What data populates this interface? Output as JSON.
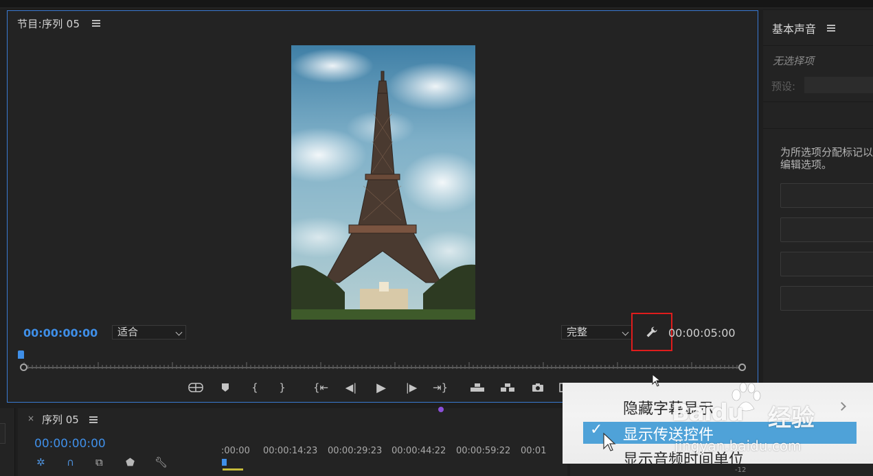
{
  "program_monitor": {
    "title": "节目:序列 05",
    "timecode_current": "00:00:00:00",
    "timecode_duration": "00:00:05:00",
    "zoom_select": "适合",
    "quality_select": "完整"
  },
  "essential_sound": {
    "title": "基本声音",
    "no_selection": "无选择项",
    "preset_label": "预设:",
    "description_line1": "为所选项分配标记以",
    "description_line2": "编辑选项。"
  },
  "timeline": {
    "close": "×",
    "title": "序列 05",
    "timecode": "00:00:00:00",
    "ruler_labels": [
      ":00:00",
      "00:00:14:23",
      "00:00:29:23",
      "00:00:44:22",
      "00:00:59:22",
      "00:01"
    ],
    "meter_label": "-12"
  },
  "context_menu": {
    "items": [
      {
        "label": "隐藏字幕显示",
        "checked": false,
        "has_submenu": true
      },
      {
        "label": "显示传送控件",
        "checked": true,
        "has_submenu": false
      },
      {
        "label": "显示音频时间单位",
        "checked": false,
        "has_submenu": false
      }
    ],
    "check_glyph": "✓"
  },
  "watermark": {
    "brand": "Baidu",
    "brand_cn": "经验",
    "url": "jingyan.baidu.com"
  },
  "colors": {
    "accent_blue": "#3f8fe8",
    "highlight_red": "#e01c1c",
    "menu_highlight": "#4fa2d8"
  }
}
